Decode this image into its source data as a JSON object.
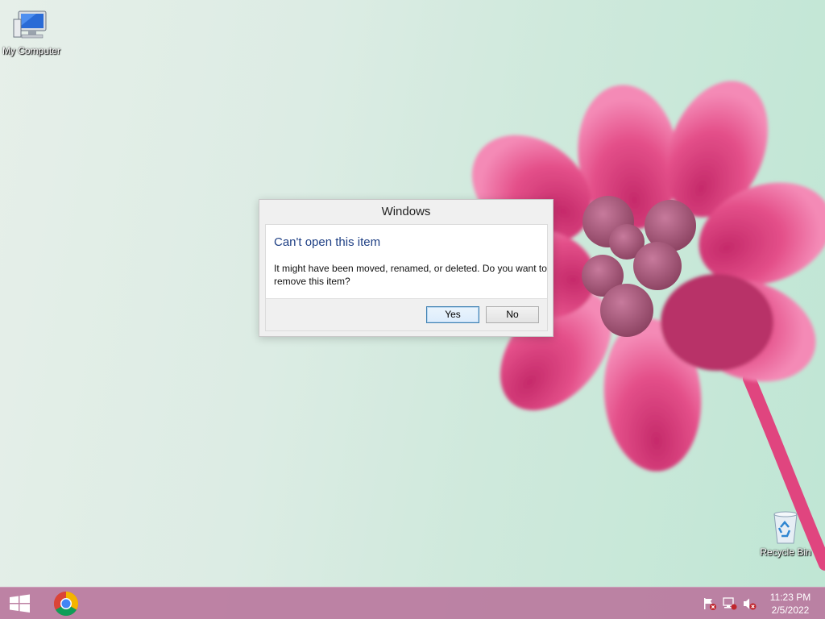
{
  "desktop": {
    "icons": [
      {
        "label": "My Computer",
        "icon": "computer-icon"
      },
      {
        "label": "Recycle Bin",
        "icon": "recycle-bin-icon"
      }
    ]
  },
  "dialog": {
    "title": "Windows",
    "heading": "Can't open this item",
    "message": "It might have been moved, renamed, or deleted. Do you want to remove this item?",
    "yes_label": "Yes",
    "no_label": "No",
    "default_button": "Yes"
  },
  "taskbar": {
    "start_icon": "windows-logo-icon",
    "pinned": [
      {
        "icon": "chrome-icon"
      }
    ],
    "tray": [
      {
        "icon": "action-center-flag-icon"
      },
      {
        "icon": "network-icon"
      },
      {
        "icon": "volume-muted-icon"
      }
    ],
    "clock": {
      "time": "11:23 PM",
      "date": "2/5/2022"
    }
  },
  "colors": {
    "taskbar": "#ba789e",
    "dialog_heading": "#1e3f84",
    "wallpaper_flower": "#e0457f"
  }
}
